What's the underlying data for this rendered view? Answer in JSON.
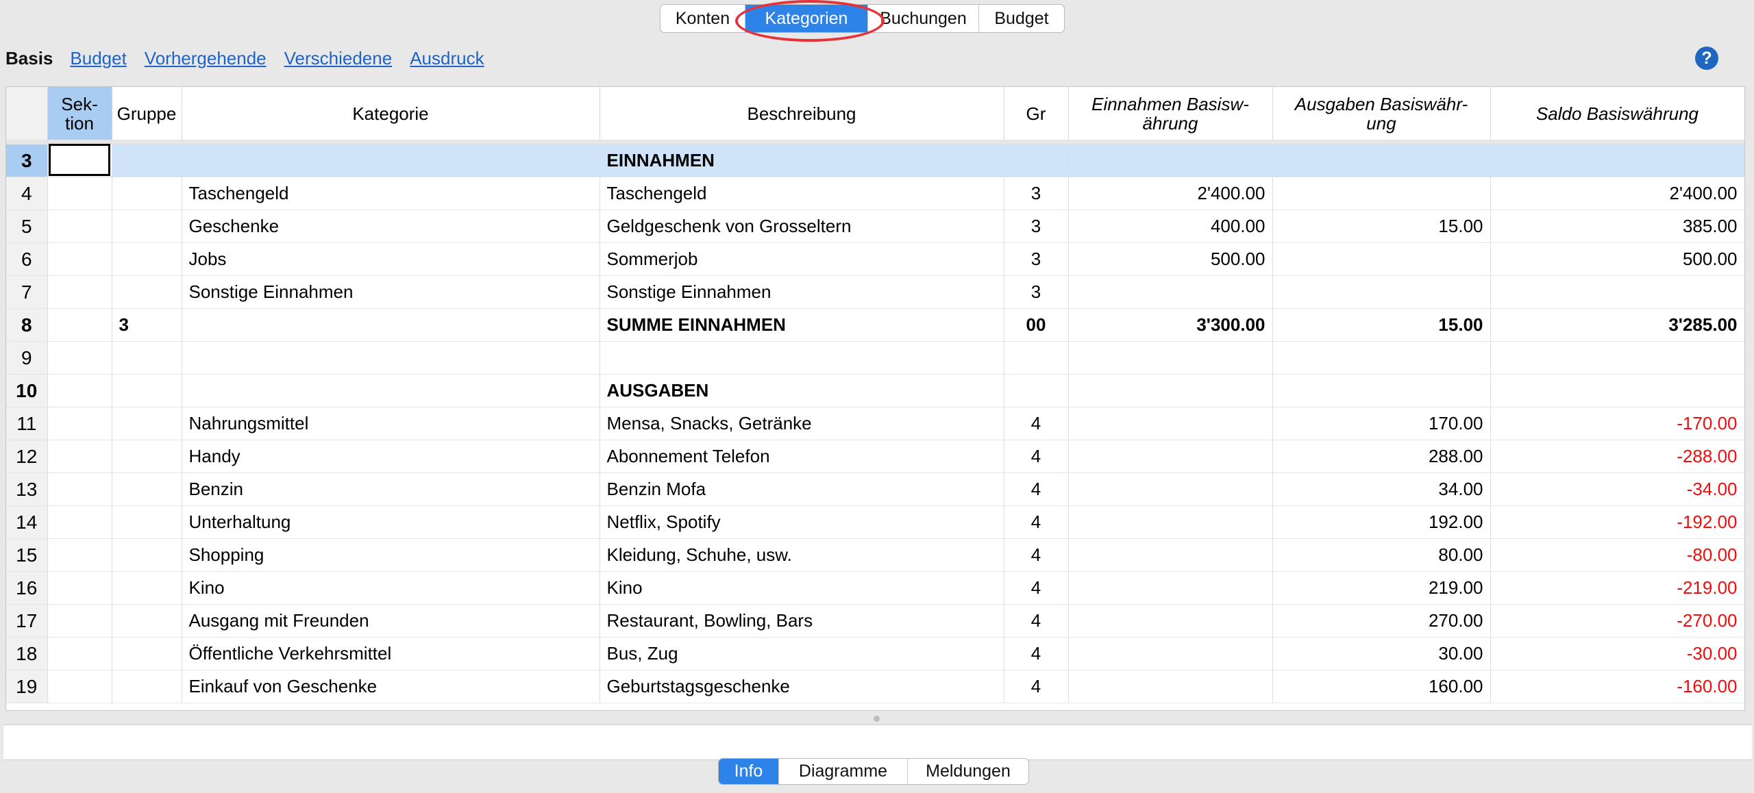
{
  "top_tabs": [
    {
      "label": "Konten",
      "active": false
    },
    {
      "label": "Kategorien",
      "active": true
    },
    {
      "label": "Buchungen",
      "active": false
    },
    {
      "label": "Budget",
      "active": false
    }
  ],
  "subnav": {
    "basis": "Basis",
    "links": [
      "Budget",
      "Vorhergehende",
      "Verschiedene",
      "Ausdruck"
    ]
  },
  "help_label": "?",
  "table": {
    "headers": {
      "sektion": "Sek-\ntion",
      "gruppe": "Gruppe",
      "kategorie": "Kategorie",
      "beschreibung": "Beschreibung",
      "gr": "Gr",
      "einnahmen": "Einnahmen Basisw-\nährung",
      "ausgaben": "Ausgaben Basiswähr-\nung",
      "saldo": "Saldo Basiswährung"
    },
    "rows": [
      {
        "n": "3",
        "sektion": "",
        "gruppe": "",
        "kategorie": "",
        "beschreibung": "EINNAHMEN",
        "gr": "",
        "einnahmen": "",
        "ausgaben": "",
        "saldo": ""
      },
      {
        "n": "4",
        "sektion": "",
        "gruppe": "",
        "kategorie": "Taschengeld",
        "beschreibung": "Taschengeld",
        "gr": "3",
        "einnahmen": "2'400.00",
        "ausgaben": "",
        "saldo": "2'400.00"
      },
      {
        "n": "5",
        "sektion": "",
        "gruppe": "",
        "kategorie": "Geschenke",
        "beschreibung": "Geldgeschenk von Grosseltern",
        "gr": "3",
        "einnahmen": "400.00",
        "ausgaben": "15.00",
        "saldo": "385.00"
      },
      {
        "n": "6",
        "sektion": "",
        "gruppe": "",
        "kategorie": "Jobs",
        "beschreibung": "Sommerjob",
        "gr": "3",
        "einnahmen": "500.00",
        "ausgaben": "",
        "saldo": "500.00"
      },
      {
        "n": "7",
        "sektion": "",
        "gruppe": "",
        "kategorie": "Sonstige Einnahmen",
        "beschreibung": "Sonstige Einnahmen",
        "gr": "3",
        "einnahmen": "",
        "ausgaben": "",
        "saldo": ""
      },
      {
        "n": "8",
        "sektion": "",
        "gruppe": "3",
        "kategorie": "",
        "beschreibung": "SUMME EINNAHMEN",
        "gr": "00",
        "einnahmen": "3'300.00",
        "ausgaben": "15.00",
        "saldo": "3'285.00"
      },
      {
        "n": "9",
        "sektion": "",
        "gruppe": "",
        "kategorie": "",
        "beschreibung": "",
        "gr": "",
        "einnahmen": "",
        "ausgaben": "",
        "saldo": ""
      },
      {
        "n": "10",
        "sektion": "",
        "gruppe": "",
        "kategorie": "",
        "beschreibung": "AUSGABEN",
        "gr": "",
        "einnahmen": "",
        "ausgaben": "",
        "saldo": ""
      },
      {
        "n": "11",
        "sektion": "",
        "gruppe": "",
        "kategorie": "Nahrungsmittel",
        "beschreibung": "Mensa, Snacks, Getränke",
        "gr": "4",
        "einnahmen": "",
        "ausgaben": "170.00",
        "saldo": "-170.00"
      },
      {
        "n": "12",
        "sektion": "",
        "gruppe": "",
        "kategorie": "Handy",
        "beschreibung": "Abonnement Telefon",
        "gr": "4",
        "einnahmen": "",
        "ausgaben": "288.00",
        "saldo": "-288.00"
      },
      {
        "n": "13",
        "sektion": "",
        "gruppe": "",
        "kategorie": "Benzin",
        "beschreibung": "Benzin Mofa",
        "gr": "4",
        "einnahmen": "",
        "ausgaben": "34.00",
        "saldo": "-34.00"
      },
      {
        "n": "14",
        "sektion": "",
        "gruppe": "",
        "kategorie": "Unterhaltung",
        "beschreibung": "Netflix, Spotify",
        "gr": "4",
        "einnahmen": "",
        "ausgaben": "192.00",
        "saldo": "-192.00"
      },
      {
        "n": "15",
        "sektion": "",
        "gruppe": "",
        "kategorie": "Shopping",
        "beschreibung": "Kleidung, Schuhe, usw.",
        "gr": "4",
        "einnahmen": "",
        "ausgaben": "80.00",
        "saldo": "-80.00"
      },
      {
        "n": "16",
        "sektion": "",
        "gruppe": "",
        "kategorie": "Kino",
        "beschreibung": "Kino",
        "gr": "4",
        "einnahmen": "",
        "ausgaben": "219.00",
        "saldo": "-219.00"
      },
      {
        "n": "17",
        "sektion": "",
        "gruppe": "",
        "kategorie": "Ausgang mit Freunden",
        "beschreibung": "Restaurant, Bowling, Bars",
        "gr": "4",
        "einnahmen": "",
        "ausgaben": "270.00",
        "saldo": "-270.00"
      },
      {
        "n": "18",
        "sektion": "",
        "gruppe": "",
        "kategorie": "Öffentliche Verkehrsmittel",
        "beschreibung": "Bus, Zug",
        "gr": "4",
        "einnahmen": "",
        "ausgaben": "30.00",
        "saldo": "-30.00"
      },
      {
        "n": "19",
        "sektion": "",
        "gruppe": "",
        "kategorie": "Einkauf von Geschenke",
        "beschreibung": "Geburtstagsgeschenke",
        "gr": "4",
        "einnahmen": "",
        "ausgaben": "160.00",
        "saldo": "-160.00"
      }
    ]
  },
  "bottom_tabs": [
    {
      "label": "Info",
      "active": true
    },
    {
      "label": "Diagramme",
      "active": false
    },
    {
      "label": "Meldungen",
      "active": false
    }
  ],
  "colors": {
    "accent": "#2d83e8",
    "negative": "#f20c0c",
    "link": "#1e64c8",
    "selection": "#cfe4f8",
    "highlight_ring": "#e5333a"
  }
}
